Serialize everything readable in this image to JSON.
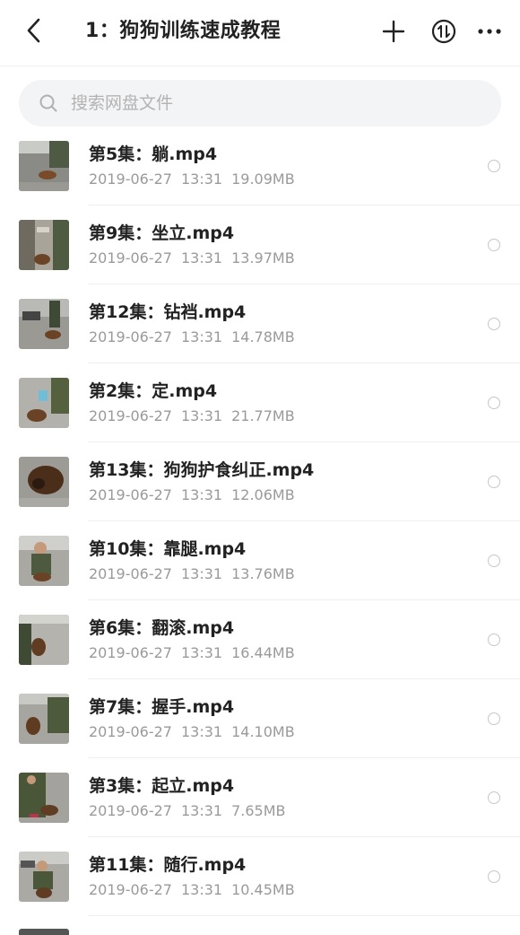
{
  "header": {
    "title": "1：狗狗训练速成教程"
  },
  "search": {
    "placeholder": "搜索网盘文件"
  },
  "files": [
    {
      "name": "第5集：躺.mp4",
      "date": "2019-06-27",
      "time": "13:31",
      "size": "19.09MB"
    },
    {
      "name": "第9集：坐立.mp4",
      "date": "2019-06-27",
      "time": "13:31",
      "size": "13.97MB"
    },
    {
      "name": "第12集：钻裆.mp4",
      "date": "2019-06-27",
      "time": "13:31",
      "size": "14.78MB"
    },
    {
      "name": "第2集：定.mp4",
      "date": "2019-06-27",
      "time": "13:31",
      "size": "21.77MB"
    },
    {
      "name": "第13集：狗狗护食纠正.mp4",
      "date": "2019-06-27",
      "time": "13:31",
      "size": "12.06MB"
    },
    {
      "name": "第10集：靠腿.mp4",
      "date": "2019-06-27",
      "time": "13:31",
      "size": "13.76MB"
    },
    {
      "name": "第6集：翻滚.mp4",
      "date": "2019-06-27",
      "time": "13:31",
      "size": "16.44MB"
    },
    {
      "name": "第7集：握手.mp4",
      "date": "2019-06-27",
      "time": "13:31",
      "size": "14.10MB"
    },
    {
      "name": "第3集：起立.mp4",
      "date": "2019-06-27",
      "time": "13:31",
      "size": "7.65MB"
    },
    {
      "name": "第11集：随行.mp4",
      "date": "2019-06-27",
      "time": "13:31",
      "size": "10.45MB"
    }
  ]
}
